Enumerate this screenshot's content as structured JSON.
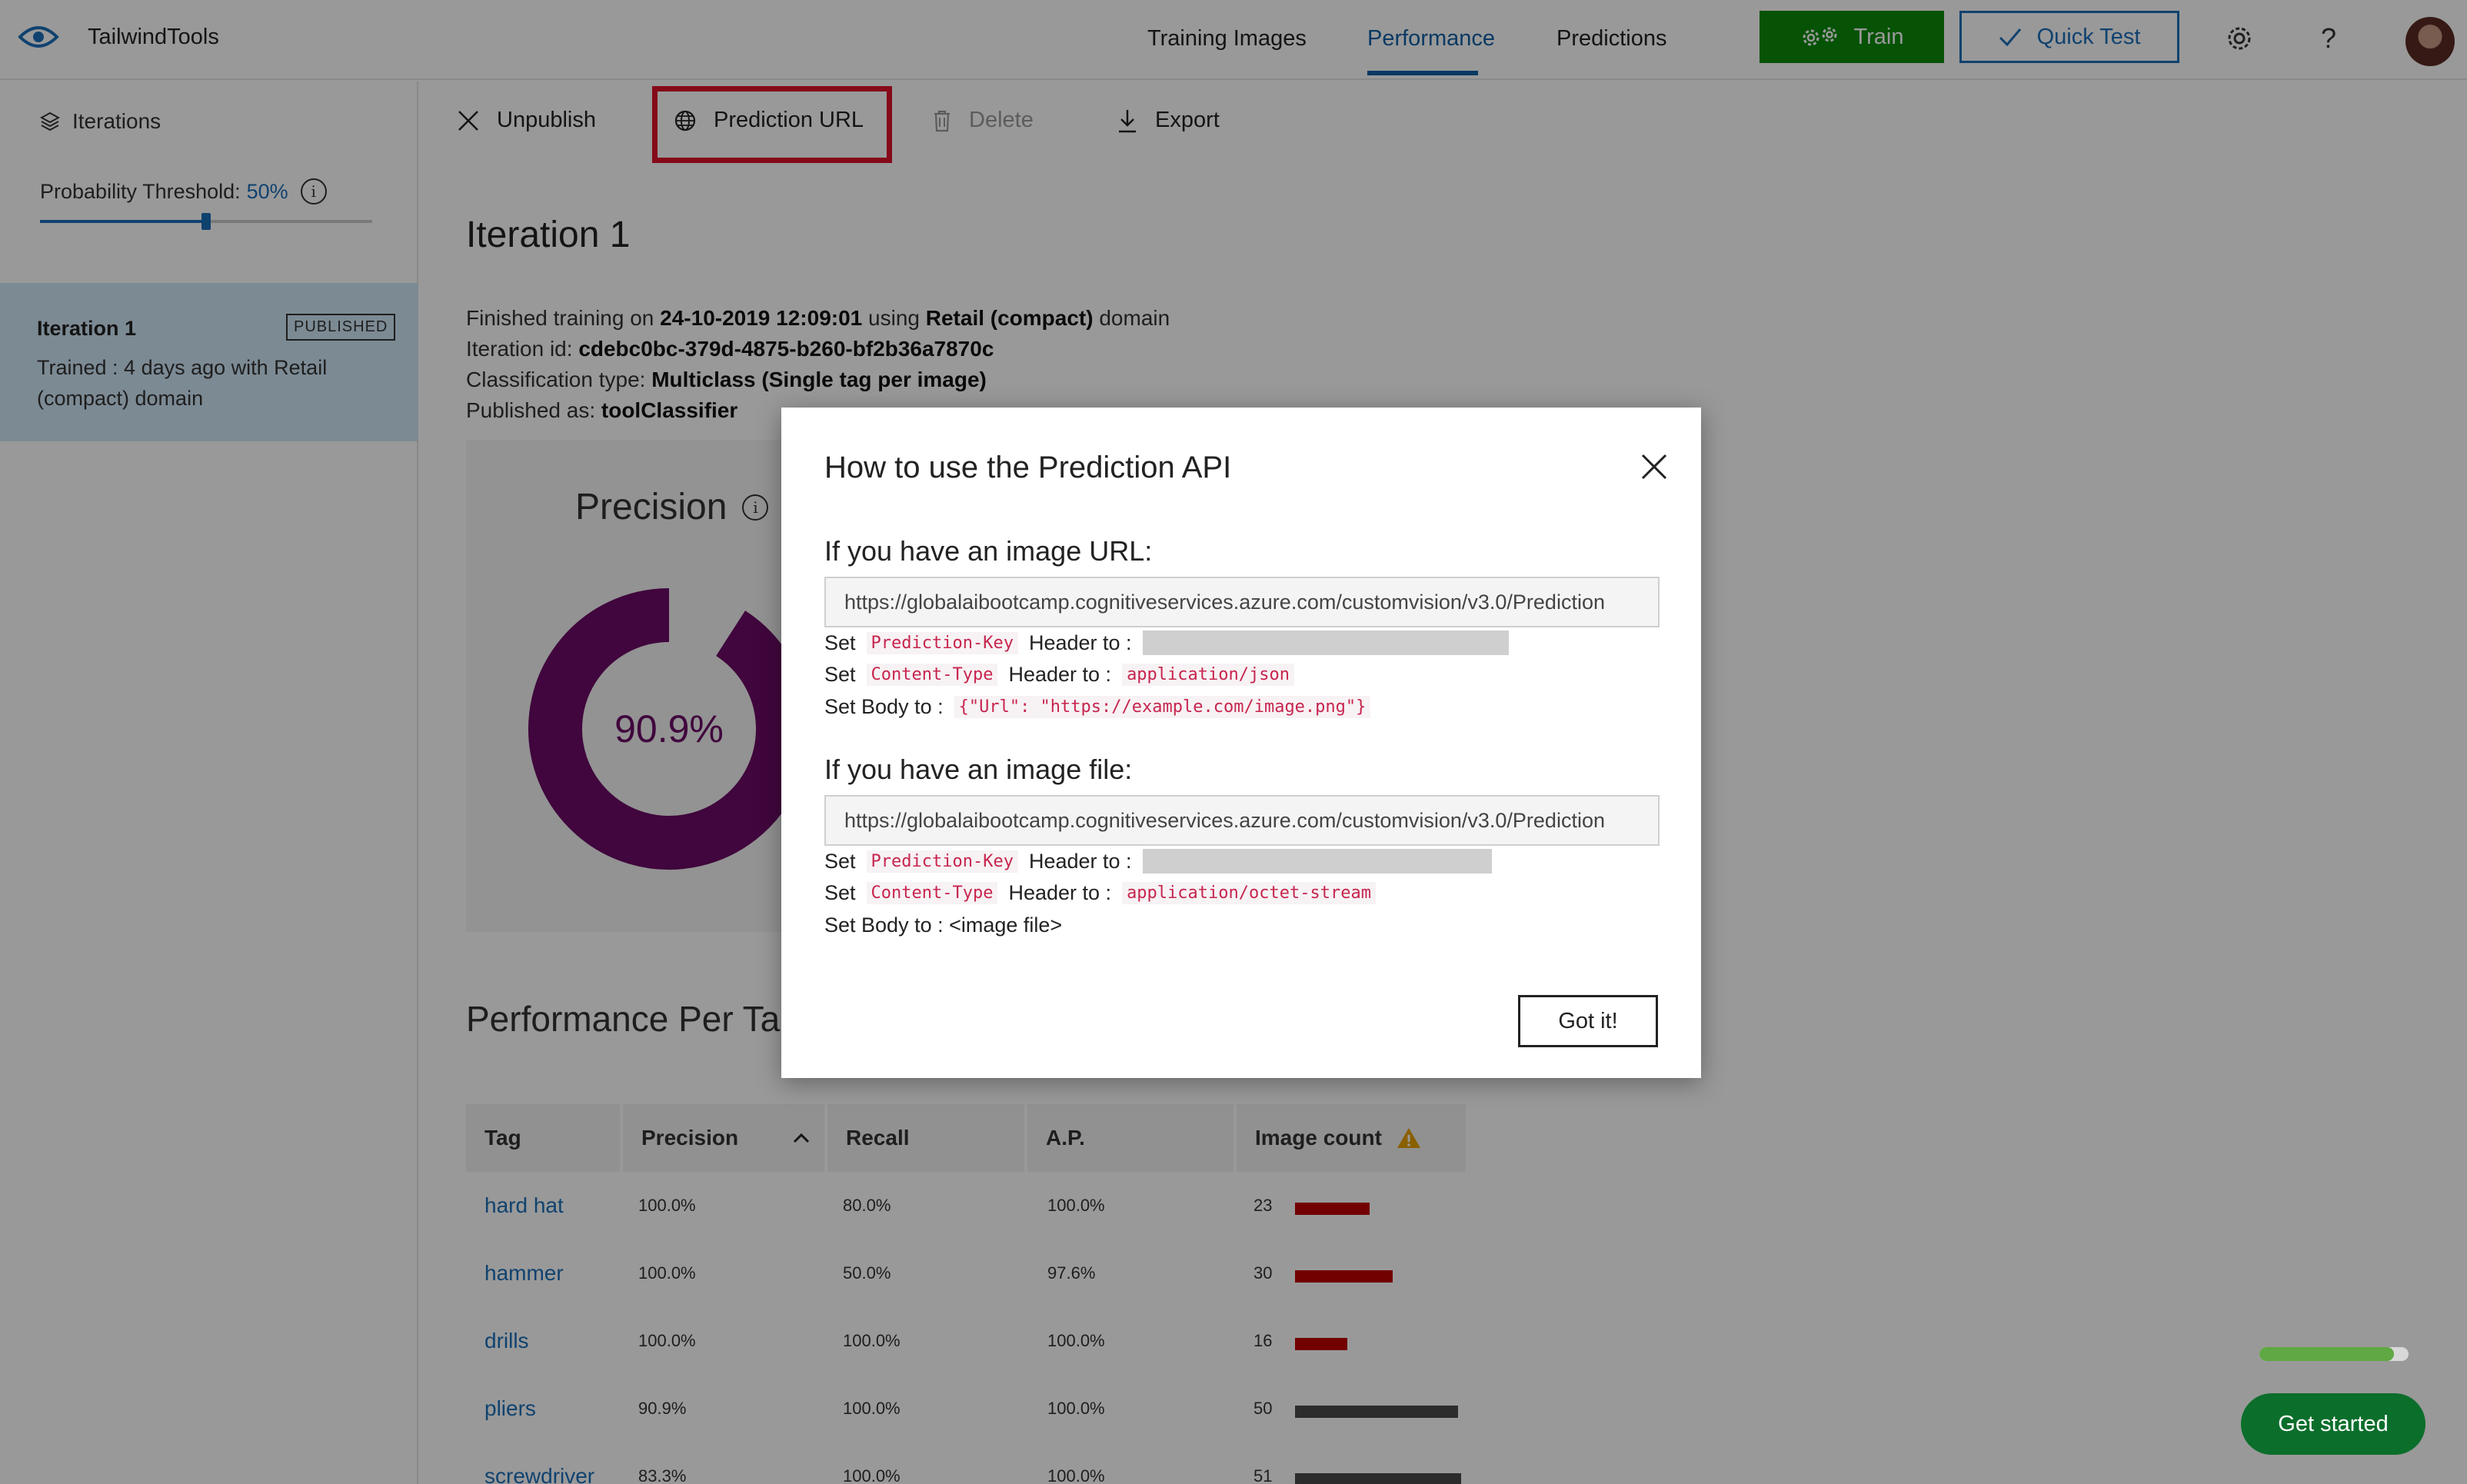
{
  "header": {
    "app_title": "TailwindTools",
    "tabs": [
      "Training Images",
      "Performance",
      "Predictions"
    ],
    "active_tab": "Performance",
    "train_label": "Train",
    "quick_test_label": "Quick Test",
    "settings_icon": "gear-icon",
    "help_label": "?",
    "colors": {
      "train_bg": "#0b8a0b",
      "accent": "#1b6fba"
    }
  },
  "sidebar": {
    "iterations_label": "Iterations",
    "threshold_label": "Probability Threshold:",
    "threshold_value": "50%",
    "threshold_fraction": 0.5,
    "iteration": {
      "name": "Iteration 1",
      "badge": "PUBLISHED",
      "description": "Trained : 4 days ago with Retail (compact) domain"
    }
  },
  "toolbar": {
    "unpublish_label": "Unpublish",
    "prediction_url_label": "Prediction URL",
    "delete_label": "Delete",
    "export_label": "Export"
  },
  "main": {
    "title": "Iteration 1",
    "finished_prefix": "Finished training on",
    "finished_date": "24-10-2019 12:09:01",
    "using_word": "using",
    "domain_name": "Retail (compact)",
    "domain_word": "domain",
    "iteration_id_label": "Iteration id:",
    "iteration_id": "cdebc0bc-379d-4875-b260-bf2b36a7870c",
    "classification_label": "Classification type:",
    "classification_value": "Multiclass (Single tag per image)",
    "published_label": "Published as:",
    "published_value": "toolClassifier",
    "precision_title": "Precision",
    "precision_value": "90.9%",
    "precision_fraction": 0.909,
    "precision_color": "#6b0a66",
    "perf_title": "Performance Per Ta"
  },
  "table": {
    "headers": {
      "tag": "Tag",
      "precision": "Precision",
      "recall": "Recall",
      "ap": "A.P.",
      "image_count": "Image count"
    },
    "rows": [
      {
        "tag": "hard hat",
        "precision": "100.0%",
        "recall": "80.0%",
        "ap": "100.0%",
        "count": "23",
        "count_num": 23,
        "status": "red"
      },
      {
        "tag": "hammer",
        "precision": "100.0%",
        "recall": "50.0%",
        "ap": "97.6%",
        "count": "30",
        "count_num": 30,
        "status": "red"
      },
      {
        "tag": "drills",
        "precision": "100.0%",
        "recall": "100.0%",
        "ap": "100.0%",
        "count": "16",
        "count_num": 16,
        "status": "red"
      },
      {
        "tag": "pliers",
        "precision": "90.9%",
        "recall": "100.0%",
        "ap": "100.0%",
        "count": "50",
        "count_num": 50,
        "status": "gray"
      },
      {
        "tag": "screwdriver",
        "precision": "83.3%",
        "recall": "100.0%",
        "ap": "100.0%",
        "count": "51",
        "count_num": 51,
        "status": "gray"
      }
    ],
    "status_colors": {
      "red": "#c00000",
      "gray": "#4a4a4a"
    }
  },
  "modal": {
    "title": "How to use the Prediction API",
    "url_section": {
      "heading": "If you have an image URL:",
      "url": "https://globalaibootcamp.cognitiveservices.azure.com/customvision/v3.0/Prediction",
      "set_word": "Set",
      "key_name": "Prediction-Key",
      "key_suffix": "Header to :",
      "ct_name": "Content-Type",
      "ct_suffix": "Header to :",
      "ct_value": "application/json",
      "body_label": "Set Body to :",
      "body_value": "{\"Url\": \"https://example.com/image.png\"}"
    },
    "file_section": {
      "heading": "If you have an image file:",
      "url": "https://globalaibootcamp.cognitiveservices.azure.com/customvision/v3.0/Prediction",
      "set_word": "Set",
      "key_name": "Prediction-Key",
      "key_suffix": "Header to :",
      "ct_name": "Content-Type",
      "ct_suffix": "Header to :",
      "ct_value": "application/octet-stream",
      "body_label": "Set Body to : <image file>"
    },
    "got_it_label": "Got it!"
  },
  "onboarding": {
    "progress_fraction": 0.9,
    "get_started_label": "Get started"
  }
}
